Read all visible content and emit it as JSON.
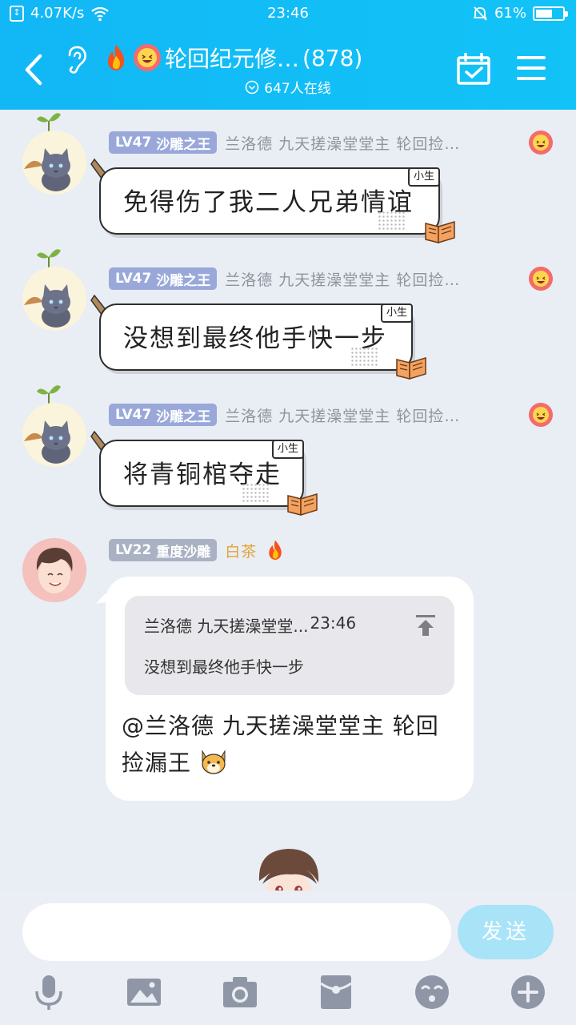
{
  "status_bar": {
    "net_speed": "4.07K/s",
    "time": "23:46",
    "battery": "61%",
    "battery_level": 0.61
  },
  "header": {
    "title": "轮回纪元修…",
    "member_count": "(878)",
    "online": "647人在线"
  },
  "messages": [
    {
      "level": "LV47",
      "title": "沙雕之王",
      "nick": "兰洛德 九天搓澡堂堂主 轮回捡…",
      "text": "免得伤了我二人兄弟情谊",
      "tag": "小生"
    },
    {
      "level": "LV47",
      "title": "沙雕之王",
      "nick": "兰洛德 九天搓澡堂堂主 轮回捡…",
      "text": "没想到最终他手快一步",
      "tag": "小生"
    },
    {
      "level": "LV47",
      "title": "沙雕之王",
      "nick": "兰洛德 九天搓澡堂堂主 轮回捡…",
      "text": "将青铜棺夺走",
      "tag": "小生"
    }
  ],
  "reply": {
    "level": "LV22",
    "title": "重度沙雕",
    "nick": "白茶",
    "quote_author": "兰洛德 九天搓澡堂堂...",
    "quote_time": "23:46",
    "quote_text": "没想到最终他手快一步",
    "text": "@兰洛德 九天搓澡堂堂主 轮回捡漏王"
  },
  "input": {
    "value": "",
    "send_label": "发送"
  },
  "colors": {
    "header": "#12b7f5",
    "level_badge": "#99a8d9",
    "send_button": "#a8e3f8",
    "chat_bg": "#e9edf4"
  },
  "toolbar_icons": [
    "microphone-icon",
    "image-icon",
    "camera-icon",
    "red-packet-icon",
    "emoji-icon",
    "plus-icon"
  ]
}
